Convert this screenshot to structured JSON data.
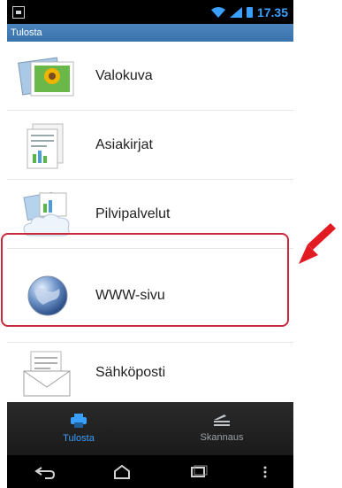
{
  "status_bar": {
    "time": "17.35"
  },
  "app_bar": {
    "title": "Tulosta"
  },
  "menu_items": [
    {
      "label": "Valokuva",
      "icon": "photo-icon"
    },
    {
      "label": "Asiakirjat",
      "icon": "documents-icon"
    },
    {
      "label": "Pilvipalvelut",
      "icon": "cloud-services-icon"
    },
    {
      "label": "WWW-sivu",
      "icon": "globe-icon"
    },
    {
      "label": "Sähköposti",
      "icon": "email-icon"
    }
  ],
  "bottom_nav": {
    "tabs": [
      {
        "label": "Tulosta",
        "icon": "printer-icon",
        "active": true
      },
      {
        "label": "Skannaus",
        "icon": "scanner-icon",
        "active": false
      }
    ]
  },
  "colors": {
    "accent": "#3aa0ff",
    "highlight": "#c82a3a",
    "title_bar": "#3a72ab"
  }
}
